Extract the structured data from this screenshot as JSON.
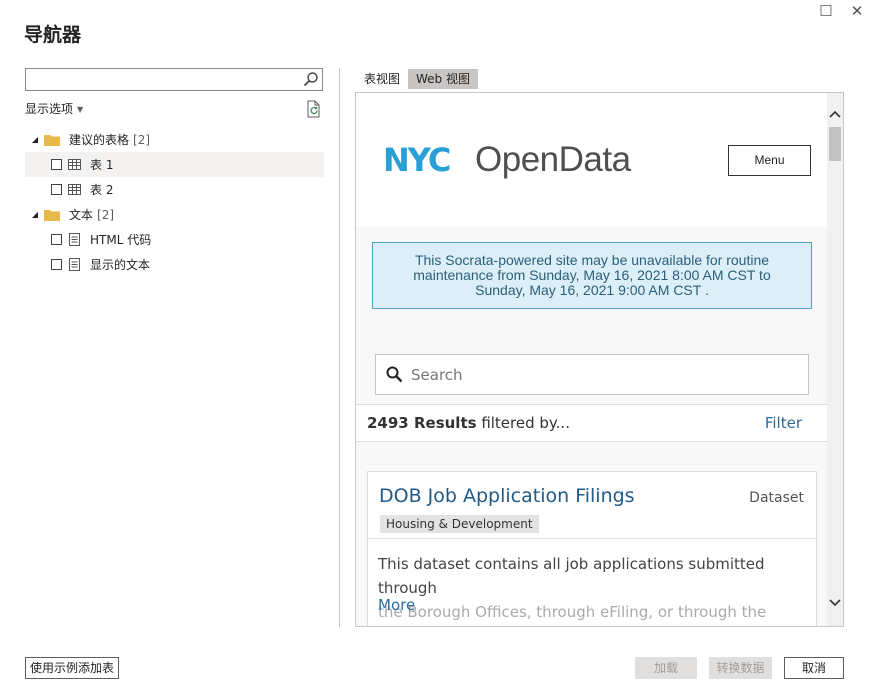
{
  "window": {
    "title": "导航器",
    "maximize_glyph": "☐",
    "close_glyph": "✕"
  },
  "left_pane": {
    "search": {
      "value": "",
      "placeholder": "",
      "icon": "search-icon"
    },
    "display_options_label": "显示选项",
    "tree": [
      {
        "type": "folder",
        "label": "建议的表格",
        "count": "[2]",
        "expanded": true,
        "children": [
          {
            "type": "table",
            "label": "表 1",
            "checked": false,
            "selected": true
          },
          {
            "type": "table",
            "label": "表 2",
            "checked": false,
            "selected": false
          }
        ]
      },
      {
        "type": "folder",
        "label": "文本",
        "count": "[2]",
        "expanded": true,
        "children": [
          {
            "type": "text",
            "label": "HTML 代码",
            "checked": false,
            "selected": false
          },
          {
            "type": "text",
            "label": "显示的文本",
            "checked": false,
            "selected": false
          }
        ]
      }
    ]
  },
  "right_pane": {
    "tabs": [
      {
        "label": "表视图",
        "active": false
      },
      {
        "label": "Web 视图",
        "active": true
      }
    ],
    "web": {
      "logo_nyc": "NYC",
      "logo_open_data": "OpenData",
      "menu_label": "Menu",
      "alert_lines": [
        "This Socrata-powered site may be unavailable for routine",
        "maintenance from  Sunday, May 16, 2021 8:00 AM CST  to",
        "Sunday, May 16, 2021 9:00 AM CST ."
      ],
      "search_placeholder": "Search",
      "results_count": "2493 Results",
      "results_suffix": " filtered by...",
      "filter_label": "Filter",
      "card": {
        "title": "DOB Job Application Filings",
        "type": "Dataset",
        "tag": "Housing & Development",
        "desc_line1": "This dataset contains all job applications submitted through",
        "desc_line2": "the Borough Offices, through eFiling, or through the HUB,",
        "more": "More"
      }
    }
  },
  "footer": {
    "add_from_example": "使用示例添加表",
    "load": "加载",
    "transform": "转换数据",
    "cancel": "取消"
  },
  "colors": {
    "nyc_blue": "#2a9fd6",
    "link_blue": "#1f5a88",
    "alert_bg": "#dceef7",
    "folder_yellow": "#e8b84a"
  }
}
